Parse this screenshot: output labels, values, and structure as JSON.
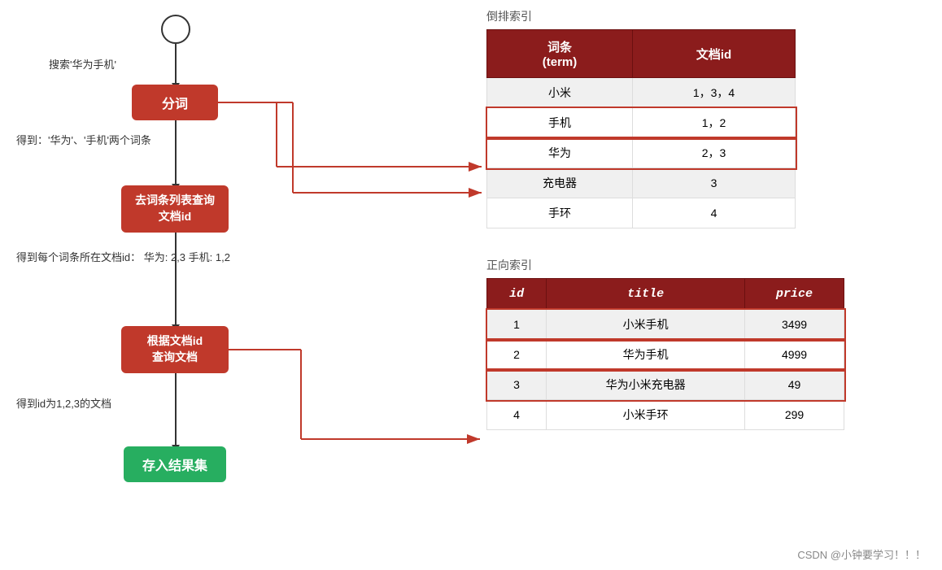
{
  "flow": {
    "search_label": "搜索'华为手机'",
    "fenci_label": "分词",
    "result_label": "得到：'华为'、'手机'两个词条",
    "query_label": "去词条列表查询\n文档id",
    "docids_label": "得到每个词条所在文档id：\n华为: 2,3\n手机: 1,2",
    "docquery_label": "根据文档id\n查询文档",
    "getdocs_label": "得到id为1,2,3的文档",
    "store_label": "存入结果集"
  },
  "inverted_index": {
    "title": "倒排索引",
    "headers": [
      "词条\n(term)",
      "文档id"
    ],
    "rows": [
      {
        "term": "小米",
        "doc_id": "1，3，4",
        "style": "light"
      },
      {
        "term": "手机",
        "doc_id": "1，2",
        "style": "highlight"
      },
      {
        "term": "华为",
        "doc_id": "2，3",
        "style": "highlight"
      },
      {
        "term": "充电器",
        "doc_id": "3",
        "style": "light"
      },
      {
        "term": "手环",
        "doc_id": "4",
        "style": "white"
      }
    ]
  },
  "forward_index": {
    "title": "正向索引",
    "headers": [
      "id",
      "title",
      "price"
    ],
    "rows": [
      {
        "id": "1",
        "title": "小米手机",
        "price": "3499",
        "highlight": true
      },
      {
        "id": "2",
        "title": "华为手机",
        "price": "4999",
        "highlight": true
      },
      {
        "id": "3",
        "title": "华为小米充电器",
        "price": "49",
        "highlight": true
      },
      {
        "id": "4",
        "title": "小米手环",
        "price": "299",
        "highlight": false
      }
    ]
  },
  "watermark": "CSDN @小钟要学习！！！"
}
